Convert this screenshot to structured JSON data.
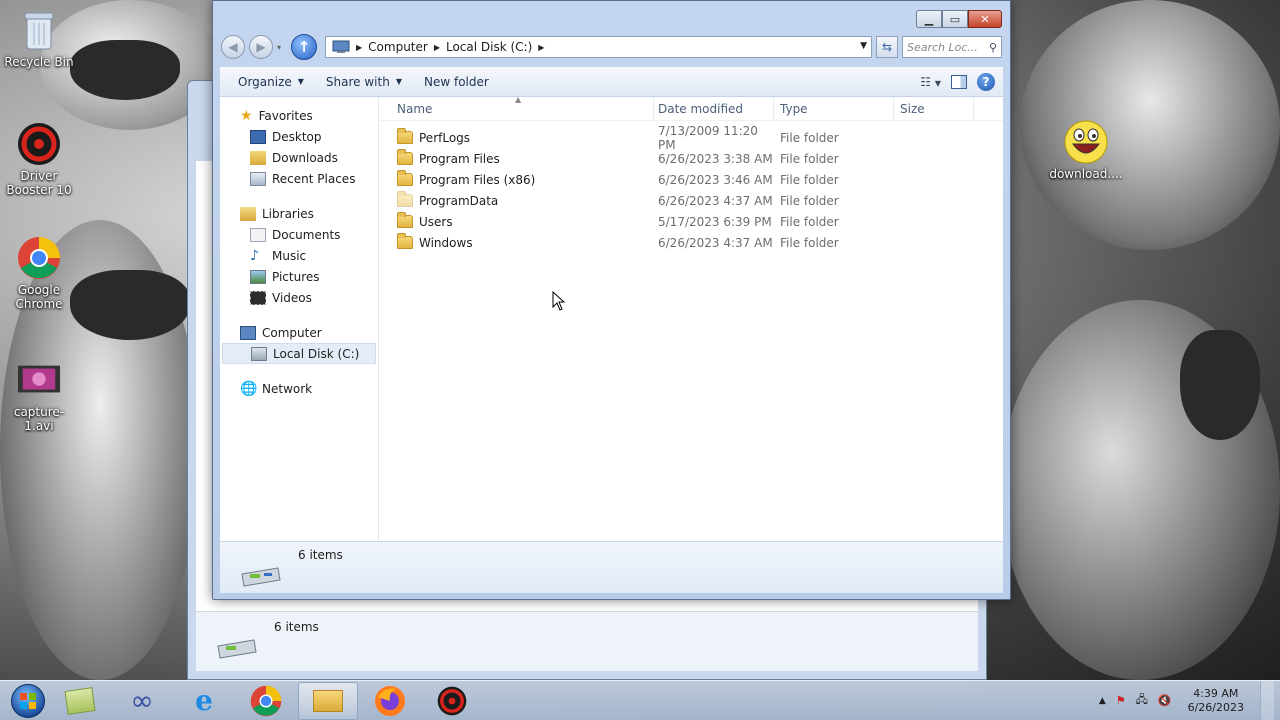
{
  "desktop": {
    "icons": [
      {
        "label": "Recycle Bin",
        "icon": "recycle-bin-icon"
      },
      {
        "label": "Driver Booster 10",
        "icon": "driver-booster-icon"
      },
      {
        "label": "Google Chrome",
        "icon": "chrome-icon"
      },
      {
        "label": "capture-1.avi",
        "icon": "video-file-icon"
      },
      {
        "label": "download....",
        "icon": "awesome-face-icon"
      }
    ]
  },
  "window": {
    "address": {
      "crumbs": [
        "Computer",
        "Local Disk (C:)"
      ]
    },
    "search_placeholder": "Search Loc...",
    "toolbar": {
      "organize": "Organize",
      "share_with": "Share with",
      "new_folder": "New folder"
    },
    "nav": {
      "favorites": {
        "label": "Favorites",
        "items": [
          "Desktop",
          "Downloads",
          "Recent Places"
        ]
      },
      "libraries": {
        "label": "Libraries",
        "items": [
          "Documents",
          "Music",
          "Pictures",
          "Videos"
        ]
      },
      "computer": {
        "label": "Computer",
        "items": [
          "Local Disk (C:)"
        ]
      },
      "network": {
        "label": "Network"
      }
    },
    "columns": {
      "name": "Name",
      "date": "Date modified",
      "type": "Type",
      "size": "Size"
    },
    "files": [
      {
        "name": "PerfLogs",
        "date": "7/13/2009 11:20 PM",
        "type": "File folder"
      },
      {
        "name": "Program Files",
        "date": "6/26/2023 3:38 AM",
        "type": "File folder"
      },
      {
        "name": "Program Files (x86)",
        "date": "6/26/2023 3:46 AM",
        "type": "File folder"
      },
      {
        "name": "ProgramData",
        "date": "6/26/2023 4:37 AM",
        "type": "File folder"
      },
      {
        "name": "Users",
        "date": "5/17/2023 6:39 PM",
        "type": "File folder"
      },
      {
        "name": "Windows",
        "date": "6/26/2023 4:37 AM",
        "type": "File folder"
      }
    ],
    "status": "6 items"
  },
  "back_window": {
    "status": "6 items"
  },
  "taskbar": {
    "apps": [
      "sticky-notes-icon",
      "infinity-app-icon",
      "internet-explorer-icon",
      "chrome-icon",
      "explorer-icon",
      "firefox-icon",
      "driver-booster-icon"
    ],
    "clock": {
      "time": "4:39 AM",
      "date": "6/26/2023"
    }
  }
}
